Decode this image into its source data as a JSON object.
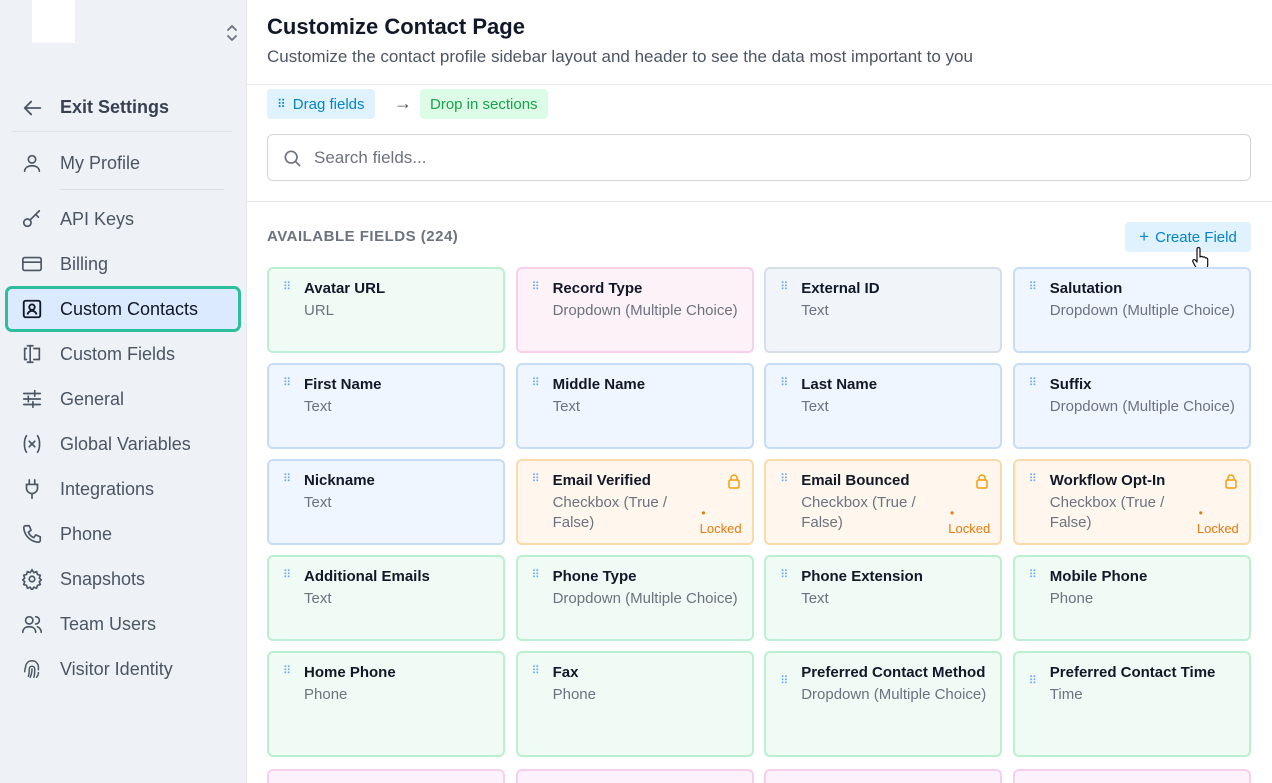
{
  "sidebar": {
    "exit_label": "Exit Settings",
    "items": [
      {
        "label": "My Profile",
        "icon": "user-icon"
      },
      {
        "label": "API Keys",
        "icon": "key-icon"
      },
      {
        "label": "Billing",
        "icon": "credit-card-icon"
      },
      {
        "label": "Custom Contacts",
        "icon": "contact-card-icon"
      },
      {
        "label": "Custom Fields",
        "icon": "text-field-icon"
      },
      {
        "label": "General",
        "icon": "sliders-icon"
      },
      {
        "label": "Global Variables",
        "icon": "variable-icon"
      },
      {
        "label": "Integrations",
        "icon": "plug-icon"
      },
      {
        "label": "Phone",
        "icon": "phone-icon"
      },
      {
        "label": "Snapshots",
        "icon": "gear-icon"
      },
      {
        "label": "Team Users",
        "icon": "users-icon"
      },
      {
        "label": "Visitor Identity",
        "icon": "fingerprint-icon"
      }
    ],
    "active_item": "Custom Contacts"
  },
  "header": {
    "title": "Customize Contact Page",
    "subtitle": "Customize the contact profile sidebar layout and header to see the data most important to you"
  },
  "hint": {
    "drag_label": "Drag fields",
    "arrow": "→",
    "drop_label": "Drop in sections"
  },
  "search": {
    "placeholder": "Search fields...",
    "value": ""
  },
  "fields_section": {
    "title": "AVAILABLE FIELDS (224)",
    "create_label": "Create Field",
    "locked_label": "Locked",
    "cards": [
      {
        "name": "Avatar URL",
        "type": "URL",
        "color": "#effbf4"
      },
      {
        "name": "Record Type",
        "type": "Dropdown (Multiple Choice)",
        "color": "#fdf2f8"
      },
      {
        "name": "External ID",
        "type": "Text",
        "color": "#f1f5f9"
      },
      {
        "name": "Salutation",
        "type": "Dropdown (Multiple Choice)",
        "color": "#eff6ff"
      },
      {
        "name": "First Name",
        "type": "Text",
        "color": "#eff6ff"
      },
      {
        "name": "Middle Name",
        "type": "Text",
        "color": "#eff6ff"
      },
      {
        "name": "Last Name",
        "type": "Text",
        "color": "#eff6ff"
      },
      {
        "name": "Suffix",
        "type": "Dropdown (Multiple Choice)",
        "color": "#eff6ff"
      },
      {
        "name": "Nickname",
        "type": "Text",
        "color": "#eff6ff"
      },
      {
        "name": "Email Verified",
        "type": "Checkbox (True / False)",
        "color": "#fff7ed",
        "locked": true
      },
      {
        "name": "Email Bounced",
        "type": "Checkbox (True / False)",
        "color": "#fff7ed",
        "locked": true
      },
      {
        "name": "Workflow Opt-In",
        "type": "Checkbox (True / False)",
        "color": "#fff7ed",
        "locked": true
      },
      {
        "name": "Additional Emails",
        "type": "Text",
        "color": "#effbf4"
      },
      {
        "name": "Phone Type",
        "type": "Dropdown (Multiple Choice)",
        "color": "#effbf4"
      },
      {
        "name": "Phone Extension",
        "type": "Text",
        "color": "#effbf4"
      },
      {
        "name": "Mobile Phone",
        "type": "Phone",
        "color": "#effbf4"
      },
      {
        "name": "Home Phone",
        "type": "Phone",
        "color": "#effbf4"
      },
      {
        "name": "Fax",
        "type": "Phone",
        "color": "#effbf4"
      },
      {
        "name": "Preferred Contact Method",
        "type": "Dropdown (Multiple Choice)",
        "color": "#effbf4"
      },
      {
        "name": "Preferred Contact Time",
        "type": "Time",
        "color": "#effbf4"
      }
    ]
  },
  "colors": {
    "accent": "#0284c7",
    "active_outline": "#2dbf9c",
    "locked": "#ea7a0c"
  }
}
